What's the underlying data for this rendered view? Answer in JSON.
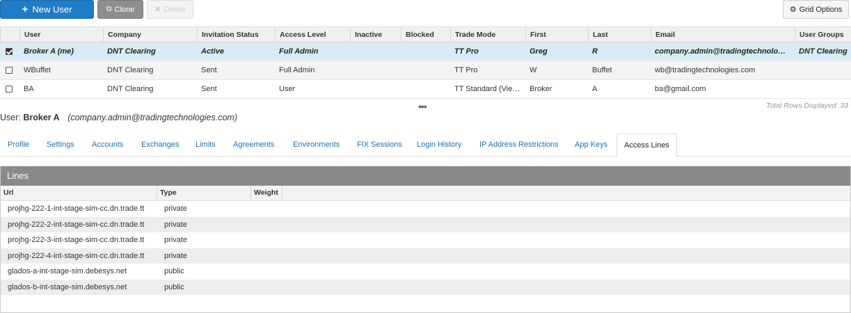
{
  "toolbar": {
    "new_user_label": "New User",
    "clone_label": "Clone",
    "delete_label": "Delete",
    "grid_options_label": "Grid Options"
  },
  "grid": {
    "columns": [
      "User",
      "Company",
      "Invitation Status",
      "Access Level",
      "Inactive",
      "Blocked",
      "Trade Mode",
      "First",
      "Last",
      "Email",
      "User Groups"
    ],
    "rows": [
      {
        "checked": true,
        "user": "Broker A (me)",
        "company": "DNT Clearing",
        "status": "Active",
        "access": "Full Admin",
        "inactive": "",
        "blocked": "",
        "trade_mode": "TT Pro",
        "first": "Greg",
        "last": "R",
        "email": "company.admin@tradingtechnolo…",
        "groups": "DNT Clearing"
      },
      {
        "checked": false,
        "user": "WBuffet",
        "company": "DNT Clearing",
        "status": "Sent",
        "access": "Full Admin",
        "inactive": "",
        "blocked": "",
        "trade_mode": "TT Pro",
        "first": "W",
        "last": "Buffet",
        "email": "wb@tradingtechnologies.com",
        "groups": ""
      },
      {
        "checked": false,
        "user": "BA",
        "company": "DNT Clearing",
        "status": "Sent",
        "access": "User",
        "inactive": "",
        "blocked": "",
        "trade_mode": "TT Standard (Vie…",
        "first": "Broker",
        "last": "A",
        "email": "ba@gmail.com",
        "groups": ""
      }
    ],
    "rows_displayed": "Total Rows Displayed: 33"
  },
  "user_label": {
    "prefix": "User:",
    "name": "Broker A",
    "email": "(company.admin@tradingtechnologies.com)"
  },
  "tabs": [
    "Profile",
    "Settings",
    "Accounts",
    "Exchanges",
    "Limits",
    "Agreements",
    "Environments",
    "FIX Sessions",
    "Login History",
    "IP Address Restrictions",
    "App Keys",
    "Access Lines"
  ],
  "lines_panel": {
    "title": "Lines",
    "columns": [
      "Url",
      "Type",
      "Weight"
    ],
    "rows": [
      {
        "url": "projhg-222-1-int-stage-sim-cc.dn.trade.tt",
        "type": "private",
        "weight": ""
      },
      {
        "url": "projhg-222-2-int-stage-sim-cc.dn.trade.tt",
        "type": "private",
        "weight": ""
      },
      {
        "url": "projhg-222-3-int-stage-sim-cc.dn.trade.tt",
        "type": "private",
        "weight": ""
      },
      {
        "url": "projhg-222-4-int-stage-sim-cc.dn.trade.tt",
        "type": "private",
        "weight": ""
      },
      {
        "url": "glados-a-int-stage-sim.debesys.net",
        "type": "public",
        "weight": ""
      },
      {
        "url": "glados-b-int-stage-sim.debesys.net",
        "type": "public",
        "weight": ""
      }
    ]
  },
  "colors": {
    "primary": "#1f7cc6",
    "link": "#1f6fb2",
    "selected_row": "#d9ecf6",
    "panel_header": "#8a8a8a"
  }
}
